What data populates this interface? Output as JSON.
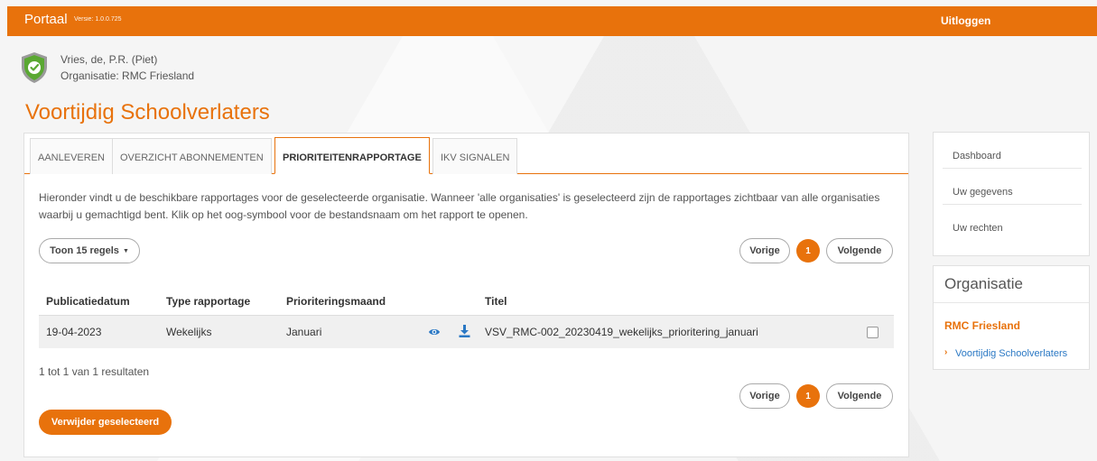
{
  "topbar": {
    "brand": "Portaal",
    "version": "Versie: 1.0.0.725",
    "logout": "Uitloggen"
  },
  "user": {
    "name": "Vries, de, P.R. (Piet)",
    "organisation": "Organisatie: RMC Friesland"
  },
  "page_title": "Voortijdig Schoolverlaters",
  "tabs": [
    {
      "label": "AANLEVEREN"
    },
    {
      "label": "OVERZICHT ABONNEMENTEN"
    },
    {
      "label": "PRIORITEITENRAPPORTAGE"
    },
    {
      "label": "IKV SIGNALEN"
    }
  ],
  "intro": "Hieronder vindt u de beschikbare rapportages voor de geselecteerde organisatie. Wanneer 'alle organisaties' is geselecteerd zijn de rapportages zichtbaar van alle organisaties waarbij u gemachtigd bent. Klik op het oog-symbool voor de bestandsnaam om het rapport te openen.",
  "rows_select": "Toon 15 regels",
  "pagination": {
    "prev": "Vorige",
    "page": "1",
    "next": "Volgende"
  },
  "table": {
    "headers": [
      "Publicatiedatum",
      "Type rapportage",
      "Prioriteringsmaand",
      "Titel"
    ],
    "rows": [
      {
        "date": "19-04-2023",
        "type": "Wekelijks",
        "month": "Januari",
        "title": "VSV_RMC-002_20230419_wekelijks_prioritering_januari"
      }
    ]
  },
  "results": "1 tot 1 van 1 resultaten",
  "delete_button": "Verwijder geselecteerd",
  "side_menu": [
    {
      "label": "Dashboard"
    },
    {
      "label": "Uw gegevens"
    },
    {
      "label": "Uw rechten"
    }
  ],
  "org_panel": {
    "heading": "Organisatie",
    "name": "RMC Friesland",
    "link": "Voortijdig Schoolverlaters"
  },
  "colors": {
    "accent": "#e8720c",
    "link": "#2a78c4",
    "shield_green": "#5aa832"
  }
}
